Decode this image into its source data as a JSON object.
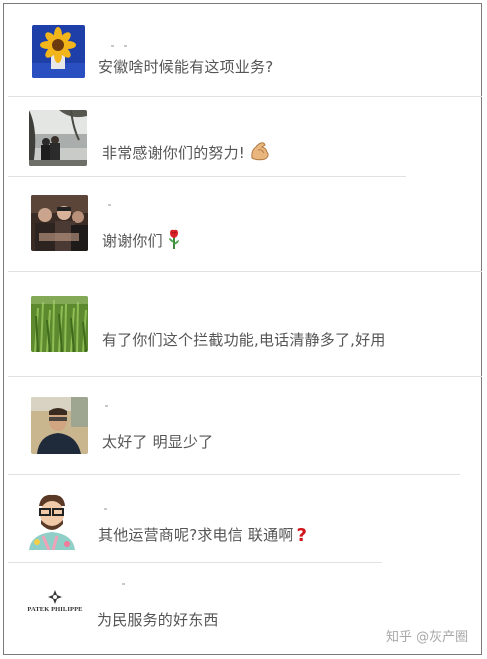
{
  "comments": [
    {
      "avatar": "sunflower-avatar",
      "text": "安徽啥时候能有这项业务?",
      "emoji": null
    },
    {
      "avatar": "couple-lake-avatar",
      "text": "非常感谢你们的努力!",
      "emoji": "flexed-biceps-emoji"
    },
    {
      "avatar": "group-photo-avatar",
      "text": "谢谢你们",
      "emoji": "rose-emoji"
    },
    {
      "avatar": "green-field-avatar",
      "text": "有了你们这个拦截功能,电话清静多了,好用",
      "emoji": null
    },
    {
      "avatar": "man-glasses-avatar",
      "text": "太好了 明显少了",
      "emoji": null
    },
    {
      "avatar": "cartoon-man-avatar",
      "text": "其他运营商呢?求电信 联通啊",
      "emoji": "red-question-mark-emoji"
    },
    {
      "avatar": "patek-philippe-avatar",
      "avatar_text": "PATEK PHILIPPE",
      "text": "为民服务的好东西",
      "emoji": null
    }
  ],
  "watermark": "知乎 @灰产圈"
}
